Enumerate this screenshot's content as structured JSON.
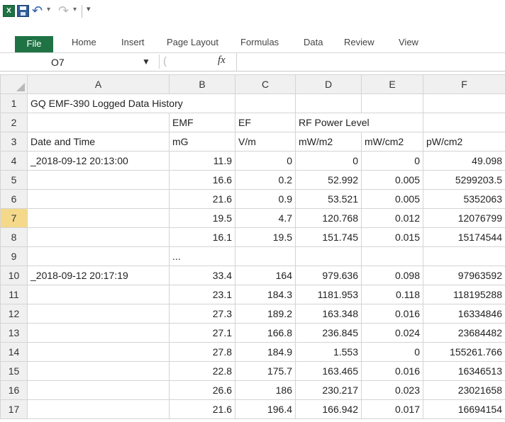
{
  "quick_access": {
    "undo_arrow": "↶",
    "redo_arrow": "↷",
    "dropdown_glyph": "▾",
    "customize_glyph": "▾",
    "icons": [
      "excel-logo-icon",
      "save-icon",
      "undo-icon",
      "redo-icon",
      "customize-qat-icon"
    ]
  },
  "ribbon": {
    "tabs": [
      "File",
      "Home",
      "Insert",
      "Page Layout",
      "Formulas",
      "Data",
      "Review",
      "View"
    ],
    "file_color": "#1f7244"
  },
  "formula_bar": {
    "name_box": "O7",
    "fx": "fx",
    "formula": ""
  },
  "sheet": {
    "columns": [
      "A",
      "B",
      "C",
      "D",
      "E",
      "F"
    ],
    "active_cell": "O7",
    "active_row": "7",
    "rows": [
      {
        "row": "1",
        "cells": [
          "GQ EMF-390 Logged Data History",
          "",
          "",
          "",
          "",
          ""
        ]
      },
      {
        "row": "2",
        "cells": [
          "",
          "EMF",
          "EF",
          "RF Power Level",
          "",
          ""
        ]
      },
      {
        "row": "3",
        "cells": [
          "Date and Time",
          "mG",
          "V/m",
          "mW/m2",
          "mW/cm2",
          "pW/cm2"
        ]
      },
      {
        "row": "4",
        "cells": [
          "_2018-09-12 20:13:00",
          "11.9",
          "0",
          "0",
          "0",
          "49.098"
        ]
      },
      {
        "row": "5",
        "cells": [
          "",
          "16.6",
          "0.2",
          "52.992",
          "0.005",
          "5299203.5"
        ]
      },
      {
        "row": "6",
        "cells": [
          "",
          "21.6",
          "0.9",
          "53.521",
          "0.005",
          "5352063"
        ]
      },
      {
        "row": "7",
        "cells": [
          "",
          "19.5",
          "4.7",
          "120.768",
          "0.012",
          "12076799"
        ]
      },
      {
        "row": "8",
        "cells": [
          "",
          "16.1",
          "19.5",
          "151.745",
          "0.015",
          "15174544"
        ]
      },
      {
        "row": "9",
        "cells": [
          "",
          "...",
          "",
          "",
          "",
          ""
        ]
      },
      {
        "row": "10",
        "cells": [
          "_2018-09-12 20:17:19",
          "33.4",
          "164",
          "979.636",
          "0.098",
          "97963592"
        ]
      },
      {
        "row": "11",
        "cells": [
          "",
          "23.1",
          "184.3",
          "1181.953",
          "0.118",
          "118195288"
        ]
      },
      {
        "row": "12",
        "cells": [
          "",
          "27.3",
          "189.2",
          "163.348",
          "0.016",
          "16334846"
        ]
      },
      {
        "row": "13",
        "cells": [
          "",
          "27.1",
          "166.8",
          "236.845",
          "0.024",
          "23684482"
        ]
      },
      {
        "row": "14",
        "cells": [
          "",
          "27.8",
          "184.9",
          "1.553",
          "0",
          "155261.766"
        ]
      },
      {
        "row": "15",
        "cells": [
          "",
          "22.8",
          "175.7",
          "163.465",
          "0.016",
          "16346513"
        ]
      },
      {
        "row": "16",
        "cells": [
          "",
          "26.6",
          "186",
          "230.217",
          "0.023",
          "23021658"
        ]
      },
      {
        "row": "17",
        "cells": [
          "",
          "21.6",
          "196.4",
          "166.942",
          "0.017",
          "16694154"
        ]
      }
    ]
  }
}
